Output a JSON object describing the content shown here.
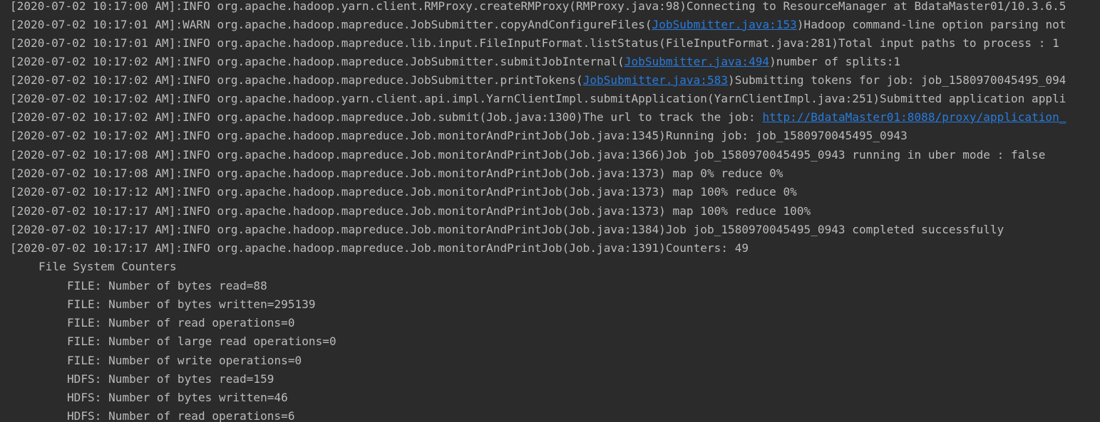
{
  "log_lines": [
    {
      "pre": "[2020-07-02 10:17:00 AM]:INFO org.apache.hadoop.yarn.client.RMProxy.createRMProxy(RMProxy.java:98)Connecting to ResourceManager at BdataMaster01/10.3.6.5",
      "link": "",
      "post": ""
    },
    {
      "pre": "[2020-07-02 10:17:01 AM]:WARN org.apache.hadoop.mapreduce.JobSubmitter.copyAndConfigureFiles(",
      "link": "JobSubmitter.java:153",
      "post": ")Hadoop command-line option parsing not"
    },
    {
      "pre": "[2020-07-02 10:17:01 AM]:INFO org.apache.hadoop.mapreduce.lib.input.FileInputFormat.listStatus(FileInputFormat.java:281)Total input paths to process : 1",
      "link": "",
      "post": ""
    },
    {
      "pre": "[2020-07-02 10:17:02 AM]:INFO org.apache.hadoop.mapreduce.JobSubmitter.submitJobInternal(",
      "link": "JobSubmitter.java:494",
      "post": ")number of splits:1"
    },
    {
      "pre": "[2020-07-02 10:17:02 AM]:INFO org.apache.hadoop.mapreduce.JobSubmitter.printTokens(",
      "link": "JobSubmitter.java:583",
      "post": ")Submitting tokens for job: job_1580970045495_094"
    },
    {
      "pre": "[2020-07-02 10:17:02 AM]:INFO org.apache.hadoop.yarn.client.api.impl.YarnClientImpl.submitApplication(YarnClientImpl.java:251)Submitted application appli",
      "link": "",
      "post": ""
    },
    {
      "pre": "[2020-07-02 10:17:02 AM]:INFO org.apache.hadoop.mapreduce.Job.submit(Job.java:1300)The url to track the job: ",
      "link": "http://BdataMaster01:8088/proxy/application_",
      "post": ""
    },
    {
      "pre": "[2020-07-02 10:17:02 AM]:INFO org.apache.hadoop.mapreduce.Job.monitorAndPrintJob(Job.java:1345)Running job: job_1580970045495_0943",
      "link": "",
      "post": ""
    },
    {
      "pre": "[2020-07-02 10:17:08 AM]:INFO org.apache.hadoop.mapreduce.Job.monitorAndPrintJob(Job.java:1366)Job job_1580970045495_0943 running in uber mode : false",
      "link": "",
      "post": ""
    },
    {
      "pre": "[2020-07-02 10:17:08 AM]:INFO org.apache.hadoop.mapreduce.Job.monitorAndPrintJob(Job.java:1373) map 0% reduce 0%",
      "link": "",
      "post": ""
    },
    {
      "pre": "[2020-07-02 10:17:12 AM]:INFO org.apache.hadoop.mapreduce.Job.monitorAndPrintJob(Job.java:1373) map 100% reduce 0%",
      "link": "",
      "post": ""
    },
    {
      "pre": "[2020-07-02 10:17:17 AM]:INFO org.apache.hadoop.mapreduce.Job.monitorAndPrintJob(Job.java:1373) map 100% reduce 100%",
      "link": "",
      "post": ""
    },
    {
      "pre": "[2020-07-02 10:17:17 AM]:INFO org.apache.hadoop.mapreduce.Job.monitorAndPrintJob(Job.java:1384)Job job_1580970045495_0943 completed successfully",
      "link": "",
      "post": ""
    },
    {
      "pre": "[2020-07-02 10:17:17 AM]:INFO org.apache.hadoop.mapreduce.Job.monitorAndPrintJob(Job.java:1391)Counters: 49",
      "link": "",
      "post": ""
    }
  ],
  "counters_group": {
    "title": "File System Counters",
    "items": [
      "FILE: Number of bytes read=88",
      "FILE: Number of bytes written=295139",
      "FILE: Number of read operations=0",
      "FILE: Number of large read operations=0",
      "FILE: Number of write operations=0",
      "HDFS: Number of bytes read=159",
      "HDFS: Number of bytes written=46",
      "HDFS: Number of read operations=6"
    ]
  },
  "colors": {
    "background": "#2b2b2b",
    "text": "#bbbbbb",
    "link": "#287bde"
  }
}
